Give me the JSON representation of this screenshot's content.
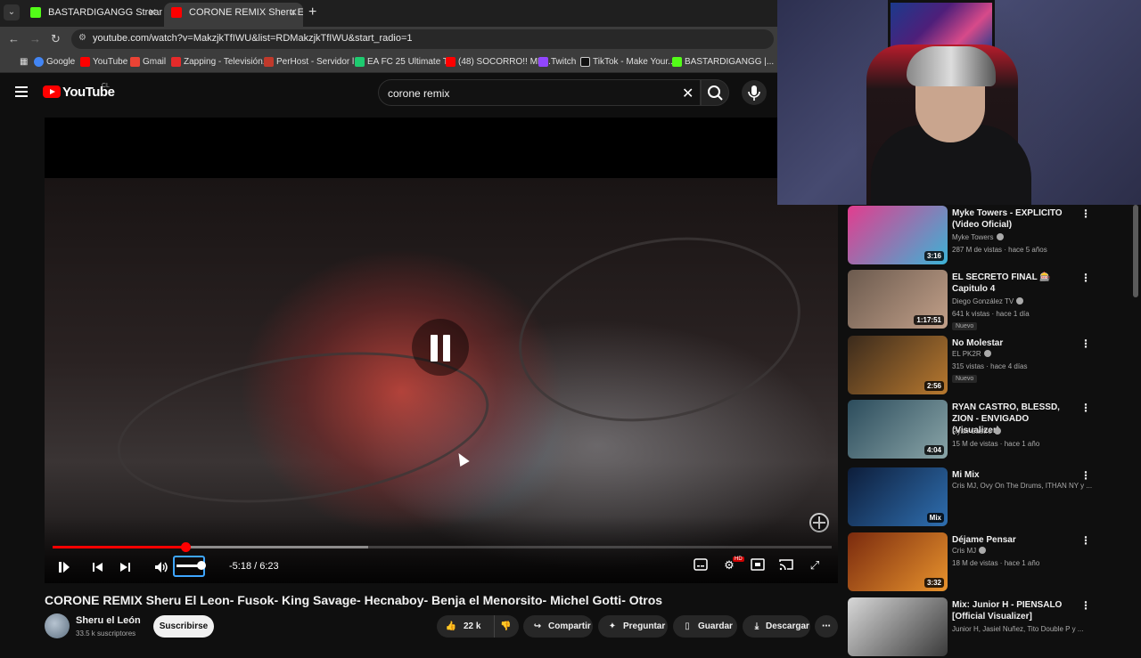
{
  "browser": {
    "tabs": [
      {
        "title": "BASTARDIGANGG Stream - Wa",
        "active": false
      },
      {
        "title": "CORONE REMIX Sheru El Le",
        "active": true
      }
    ],
    "url": "youtube.com/watch?v=MakzjkTfIWU&list=RDMakzjkTfIWU&start_radio=1",
    "bookmarks": [
      "Google",
      "YouTube",
      "Gmail",
      "Zapping - Televisión...",
      "PerHost - Servidor l...",
      "EA FC 25 Ultimate T...",
      "(48) SOCORRO!! ME...",
      "Twitch",
      "TikTok - Make Your...",
      "BASTARDIGANGG |..."
    ]
  },
  "youtube": {
    "logo": "YouTube",
    "country": "CL",
    "search": {
      "query": "corone remix"
    }
  },
  "player": {
    "time": "-5:18 / 6:23",
    "progress_fraction": 0.17,
    "buffer_fraction": 0.405,
    "volume_fraction": 0.9,
    "state": "paused"
  },
  "video": {
    "title": "CORONE REMIX Sheru El Leon- Fusok- King Savage- Hecnaboy- Benja el Menorsito- Michel Gotti- Otros",
    "channel": "Sheru el León",
    "subscribers": "33.5 k suscriptores",
    "subscribe_label": "Suscribirse",
    "likes": "22 k",
    "share_label": "Compartir",
    "ask_label": "Preguntar",
    "save_label": "Guardar",
    "download_label": "Descargar"
  },
  "recommendations": [
    {
      "title": "Myke Towers - EXPLICITO (Video Oficial)",
      "channel": "Myke Towers",
      "verified": true,
      "meta": "287 M de vistas · hace 5 años",
      "duration": "3:16",
      "badge": "",
      "colors": [
        "#e33c8e",
        "#3bb3d6"
      ]
    },
    {
      "title": "EL SECRETO FINAL 🎰 Capitulo 4",
      "channel": "Diego González TV",
      "verified": true,
      "meta": "641 k vistas · hace 1 día",
      "duration": "1:17:51",
      "badge": "Nuevo",
      "colors": [
        "#6b5a4e",
        "#c2a089"
      ]
    },
    {
      "title": "No Molestar",
      "channel": "EL PK2R",
      "verified": true,
      "meta": "315 vistas · hace 4 días",
      "duration": "2:56",
      "badge": "Nuevo",
      "colors": [
        "#3a2a1c",
        "#b8792f"
      ]
    },
    {
      "title": "RYAN CASTRO, BLESSD, ZION - ENVIGADO (Visualizer)",
      "channel": "Ryan Castro",
      "verified": true,
      "meta": "15 M de vistas · hace 1 año",
      "duration": "4:04",
      "badge": "",
      "colors": [
        "#2c4c5c",
        "#8aa5a8"
      ]
    },
    {
      "title": "Mi Mix",
      "channel": "Cris MJ, Ovy On The Drums, ITHAN NY y ...",
      "verified": false,
      "meta": "",
      "duration": "Mix",
      "badge": "",
      "colors": [
        "#0d1d3a",
        "#2f6fb0"
      ]
    },
    {
      "title": "Déjame Pensar",
      "channel": "Cris MJ",
      "verified": true,
      "meta": "18 M de vistas · hace 1 año",
      "duration": "3:32",
      "badge": "",
      "colors": [
        "#7a2a0e",
        "#e8932d"
      ]
    },
    {
      "title": "Mix: Junior H - PIENSALO [Official Visualizer]",
      "channel": "Junior H, Jasiel Nuñez, Tito Double P y ...",
      "verified": false,
      "meta": "",
      "duration": "",
      "badge": "",
      "colors": [
        "#d8d8d8",
        "#3a3a3a"
      ]
    }
  ],
  "colors": {
    "accent": "#ff0000",
    "background": "#0f0f0f",
    "focus": "#3ea6ff"
  }
}
